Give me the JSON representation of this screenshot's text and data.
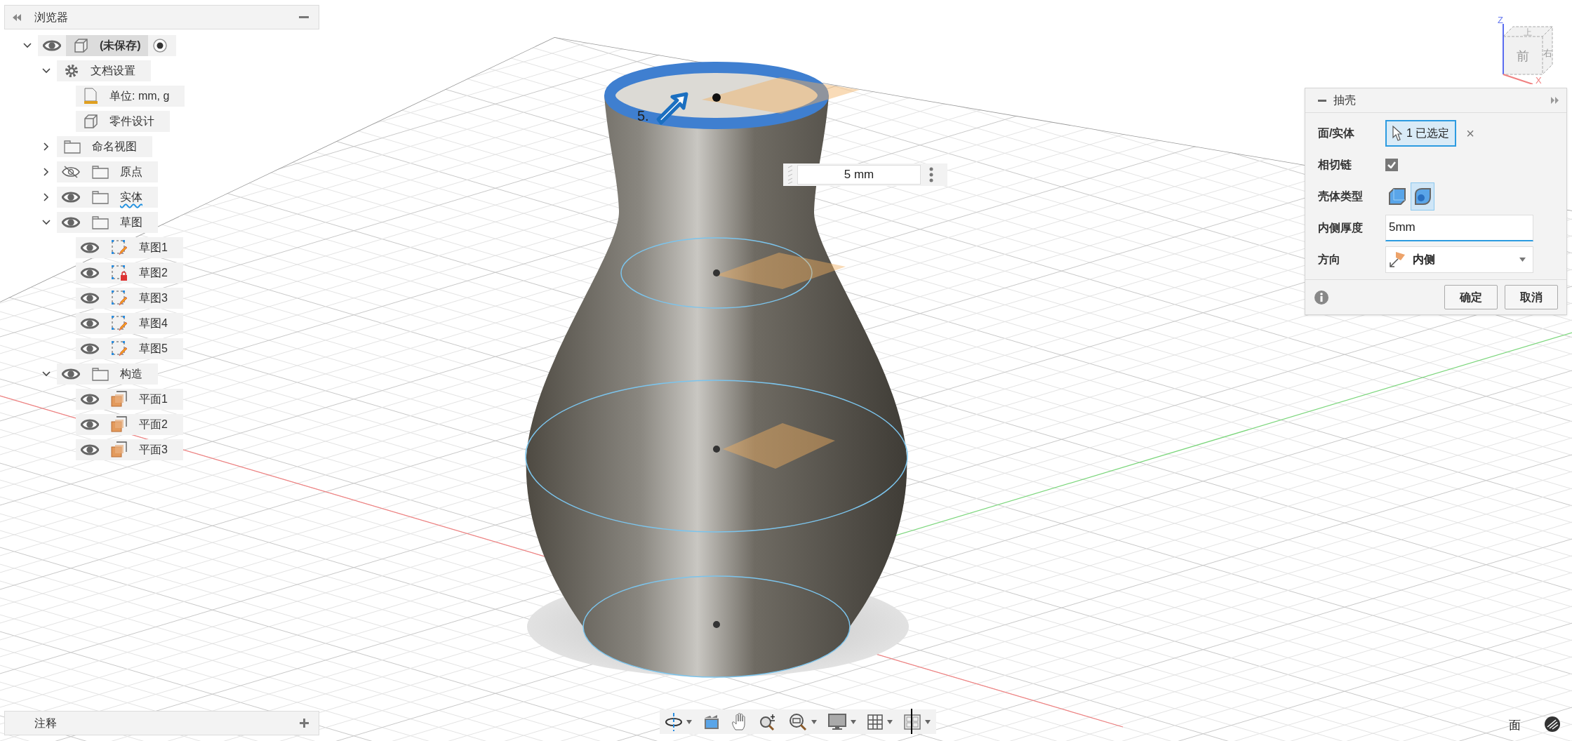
{
  "browser": {
    "title": "浏览器",
    "tree": [
      {
        "label": "(未保存)",
        "kind": "component",
        "expanded": true,
        "visible": true,
        "selected": true,
        "children": [
          {
            "label": "文档设置",
            "kind": "settings",
            "expanded": true,
            "selected": false,
            "children": [
              {
                "label": "单位: mm, g",
                "kind": "units",
                "selected": false
              },
              {
                "label": "零件设计",
                "kind": "body",
                "selected": false
              }
            ]
          },
          {
            "label": "命名视图",
            "kind": "folder",
            "expanded": false,
            "selected": false
          },
          {
            "label": "原点",
            "kind": "folder",
            "expanded": false,
            "visible": false,
            "selected": false
          },
          {
            "label": "实体",
            "kind": "folder",
            "expanded": false,
            "visible": true,
            "selected": false,
            "underlined": true
          },
          {
            "label": "草图",
            "kind": "folder",
            "expanded": true,
            "visible": true,
            "selected": false,
            "children": [
              {
                "label": "草图1",
                "kind": "sketch",
                "visible": true,
                "locked": false,
                "selected": false
              },
              {
                "label": "草图2",
                "kind": "sketch",
                "visible": true,
                "locked": true,
                "selected": false
              },
              {
                "label": "草图3",
                "kind": "sketch",
                "visible": true,
                "locked": false,
                "selected": false
              },
              {
                "label": "草图4",
                "kind": "sketch",
                "visible": true,
                "locked": false,
                "selected": false
              },
              {
                "label": "草图5",
                "kind": "sketch",
                "visible": true,
                "locked": false,
                "selected": false
              }
            ]
          },
          {
            "label": "构造",
            "kind": "folder",
            "expanded": true,
            "visible": true,
            "selected": false,
            "children": [
              {
                "label": "平面1",
                "kind": "plane",
                "visible": true,
                "selected": false
              },
              {
                "label": "平面2",
                "kind": "plane",
                "visible": true,
                "selected": false
              },
              {
                "label": "平面3",
                "kind": "plane",
                "visible": true,
                "selected": false
              }
            ]
          }
        ]
      }
    ]
  },
  "viewport": {
    "dimension_label": "5.",
    "dimension_input": {
      "value": "5 mm"
    },
    "viewcube": {
      "front": "前",
      "right": "右",
      "top": "上",
      "axis_z": "Z",
      "axis_x": "X"
    },
    "selection_filter": "面"
  },
  "shell_dialog": {
    "title": "抽壳",
    "rows": [
      {
        "kind": "selection",
        "label": "面/实体",
        "value": "1 已选定",
        "clear": "×"
      },
      {
        "kind": "checkbox",
        "label": "相切链",
        "checked": true
      },
      {
        "kind": "shell-type",
        "label": "壳体类型",
        "options": [
          {
            "kind": "sharp",
            "selected": false
          },
          {
            "kind": "rounded",
            "selected": true
          }
        ]
      },
      {
        "kind": "input",
        "label": "内侧厚度",
        "value": "5mm"
      },
      {
        "kind": "dropdown",
        "label": "方向",
        "value": "内侧"
      }
    ],
    "buttons": [
      "确定",
      "取消"
    ]
  },
  "comments_panel": {
    "title": "注释"
  }
}
